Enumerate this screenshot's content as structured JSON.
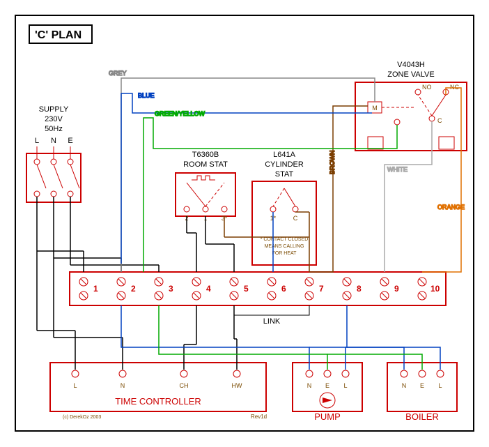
{
  "title": "'C' PLAN",
  "supply": {
    "label1": "SUPPLY",
    "label2": "230V",
    "label3": "50Hz",
    "L": "L",
    "N": "N",
    "E": "E"
  },
  "roomstat": {
    "model": "T6360B",
    "name": "ROOM STAT",
    "t1": "2",
    "t2": "1",
    "t3": "3*"
  },
  "cylstat": {
    "model": "L641A",
    "name": "CYLINDER",
    "name2": "STAT",
    "t1": "1*",
    "t2": "C",
    "note1": "* CONTACT CLOSED",
    "note2": "MEANS CALLING",
    "note3": "FOR HEAT"
  },
  "zone": {
    "model": "V4043H",
    "name": "ZONE VALVE",
    "M": "M",
    "NO": "NO",
    "NC": "NC",
    "C": "C"
  },
  "strip": {
    "n1": "1",
    "n2": "2",
    "n3": "3",
    "n4": "4",
    "n5": "5",
    "n6": "6",
    "n7": "7",
    "n8": "8",
    "n9": "9",
    "n10": "10",
    "link": "LINK"
  },
  "wires": {
    "grey": "GREY",
    "blue": "BLUE",
    "gy": "GREEN/YELLOW",
    "brown": "BROWN",
    "white": "WHITE",
    "orange": "ORANGE"
  },
  "tc": {
    "name": "TIME CONTROLLER",
    "L": "L",
    "N": "N",
    "CH": "CH",
    "HW": "HW"
  },
  "pump": {
    "name": "PUMP",
    "N": "N",
    "E": "E",
    "L": "L"
  },
  "boiler": {
    "name": "BOILER",
    "N": "N",
    "E": "E",
    "L": "L"
  },
  "credits": {
    "copyright": "(c) DerekOz 2003",
    "rev": "Rev1d"
  }
}
